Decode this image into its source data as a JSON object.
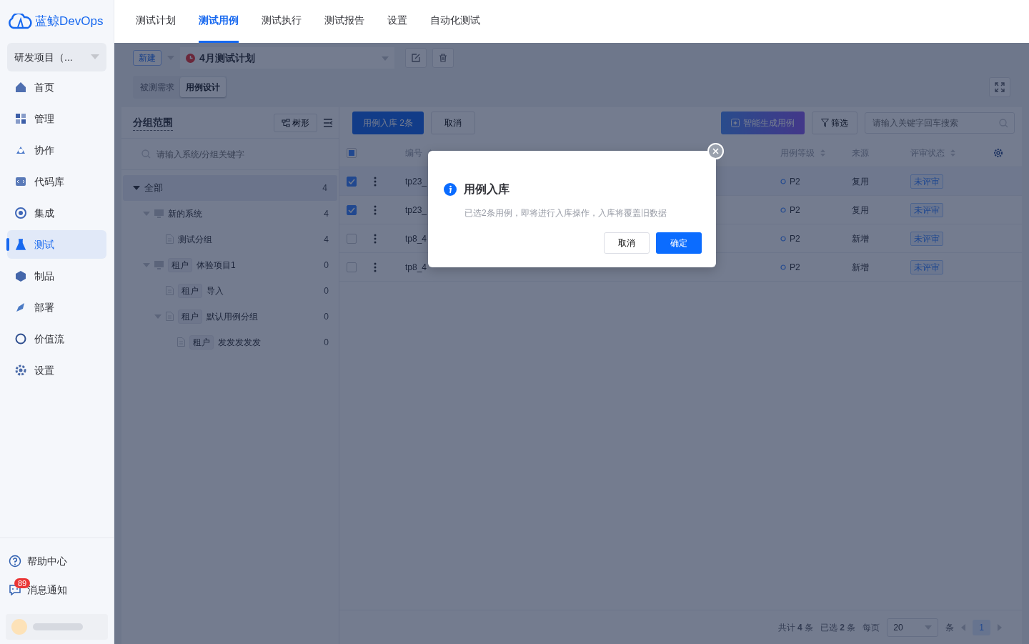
{
  "brand": {
    "name": "蓝鲸DevOps"
  },
  "project_selector": {
    "value": "研发项目（..."
  },
  "sidebar": {
    "items": [
      {
        "label": "首页",
        "selected": false
      },
      {
        "label": "管理",
        "selected": false
      },
      {
        "label": "协作",
        "selected": false
      },
      {
        "label": "代码库",
        "selected": false
      },
      {
        "label": "集成",
        "selected": false
      },
      {
        "label": "测试",
        "selected": true
      },
      {
        "label": "制品",
        "selected": false
      },
      {
        "label": "部署",
        "selected": false
      },
      {
        "label": "价值流",
        "selected": false
      },
      {
        "label": "设置",
        "selected": false
      }
    ],
    "footer": [
      {
        "kind": "help",
        "label": "帮助中心"
      },
      {
        "kind": "messages",
        "label": "消息通知",
        "badge": "89"
      }
    ]
  },
  "top_tabs": [
    {
      "label": "测试计划",
      "selected": false
    },
    {
      "label": "测试用例",
      "selected": true
    },
    {
      "label": "测试执行",
      "selected": false
    },
    {
      "label": "测试报告",
      "selected": false
    },
    {
      "label": "设置",
      "selected": false
    },
    {
      "label": "自动化测试",
      "selected": false
    }
  ],
  "toolbar": {
    "new_button": "新建",
    "plan": "4月测试计划"
  },
  "sub_tabs": [
    {
      "label": "被测需求",
      "selected": false
    },
    {
      "label": "用例设计",
      "selected": true
    }
  ],
  "group_panel": {
    "title": "分组范围",
    "tree_button": "树形",
    "search_placeholder": "请输入系统/分组关键字",
    "tree": [
      {
        "kind": "root",
        "label": "全部",
        "count": "4",
        "selected": true,
        "expanded": true,
        "children": [
          {
            "kind": "system",
            "label": "新的系统",
            "count": "4",
            "selected": false,
            "expanded": true,
            "children": [
              {
                "kind": "group",
                "label": "测试分组",
                "count": "4",
                "selected": false
              }
            ]
          },
          {
            "kind": "system",
            "tag": "租户",
            "label": "体验项目1",
            "count": "0",
            "selected": false,
            "expanded": true,
            "children": [
              {
                "kind": "group",
                "tag": "租户",
                "label": "导入",
                "count": "0",
                "selected": false
              },
              {
                "kind": "group",
                "tag": "租户",
                "label": "默认用例分组",
                "count": "0",
                "selected": false,
                "expanded": true,
                "children": [
                  {
                    "kind": "group",
                    "tag": "租户",
                    "label": "发发发发发",
                    "count": "0",
                    "selected": false
                  }
                ]
              }
            ]
          }
        ]
      }
    ]
  },
  "case_toolbar": {
    "import_button": "用例入库 2条",
    "cancel_button": "取消",
    "ai_button": "智能生成用例",
    "filter_button": "筛选",
    "search_placeholder": "请输入关键字回车搜索"
  },
  "table": {
    "header_indeterminate": true,
    "columns": [
      {
        "label": "编号",
        "sortable": true
      },
      {
        "label": "用例等级",
        "sortable": true
      },
      {
        "label": "来源",
        "sortable": false
      },
      {
        "label": "评审状态",
        "sortable": true
      }
    ],
    "rows": [
      {
        "checked": true,
        "id": "tp23_",
        "level": "P2",
        "source": "复用",
        "review": "未评审"
      },
      {
        "checked": true,
        "id": "tp23_",
        "level": "P2",
        "source": "复用",
        "review": "未评审"
      },
      {
        "checked": false,
        "id": "tp8_4",
        "level": "P2",
        "source": "新增",
        "review": "未评审"
      },
      {
        "checked": false,
        "id": "tp8_4",
        "level": "P2",
        "source": "新增",
        "review": "未评审"
      }
    ]
  },
  "pagination": {
    "total": "共计 **4** 条",
    "selected": "已选 **2** 条",
    "per_page_label": "每页",
    "per_page": "20",
    "per_page_unit": "条",
    "pages": [
      {
        "label": "1",
        "selected": true
      }
    ]
  },
  "dialog": {
    "title": "用例入库",
    "message": "已选2条用例，即将进行入库操作，入库将覆盖旧数据",
    "cancel": "取消",
    "confirm": "确定"
  }
}
